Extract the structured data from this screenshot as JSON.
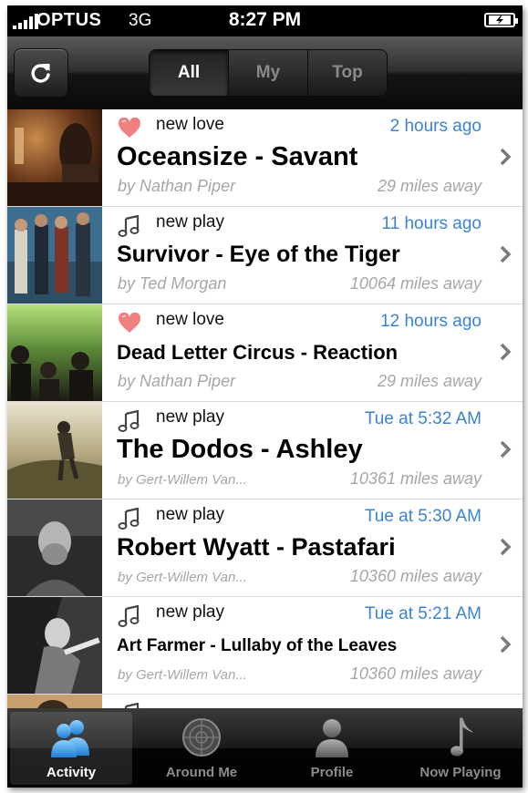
{
  "status_bar": {
    "carrier": "OPTUS",
    "network": "3G",
    "time": "8:27 PM"
  },
  "nav": {
    "refresh_icon": "refresh-icon",
    "segments": [
      "All",
      "My",
      "Top"
    ],
    "selected_segment": "All"
  },
  "activity": [
    {
      "type": "new love",
      "icon": "heart-icon",
      "time": "2 hours ago",
      "title": "Oceansize - Savant",
      "by": "by Nathan Piper",
      "distance": "29 miles away"
    },
    {
      "type": "new play",
      "icon": "music-note-icon",
      "time": "11 hours ago",
      "title": "Survivor - Eye of the Tiger",
      "by": "by Ted Morgan",
      "distance": "10064 miles away"
    },
    {
      "type": "new love",
      "icon": "heart-icon",
      "time": "12 hours ago",
      "title": "Dead Letter Circus - Reaction",
      "by": "by Nathan Piper",
      "distance": "29 miles away"
    },
    {
      "type": "new play",
      "icon": "music-note-icon",
      "time": "Tue at 5:32 AM",
      "title": "The Dodos - Ashley",
      "by": "by Gert-Willem Van...",
      "distance": "10361 miles away"
    },
    {
      "type": "new play",
      "icon": "music-note-icon",
      "time": "Tue at 5:30 AM",
      "title": "Robert Wyatt - Pastafari",
      "by": "by Gert-Willem Van...",
      "distance": "10360 miles away"
    },
    {
      "type": "new play",
      "icon": "music-note-icon",
      "time": "Tue at 5:21 AM",
      "title": "Art Farmer - Lullaby of the Leaves",
      "by": "by Gert-Willem Van...",
      "distance": "10360 miles away"
    }
  ],
  "tab_bar": [
    {
      "label": "Activity",
      "icon": "people-icon",
      "active": true
    },
    {
      "label": "Around Me",
      "icon": "radar-icon",
      "active": false
    },
    {
      "label": "Profile",
      "icon": "person-icon",
      "active": false
    },
    {
      "label": "Now Playing",
      "icon": "music-note-icon",
      "active": false
    }
  ],
  "colors": {
    "accent_time": "#3b83d1",
    "secondary_text": "#a6a6a6",
    "heart": "#f08080"
  }
}
